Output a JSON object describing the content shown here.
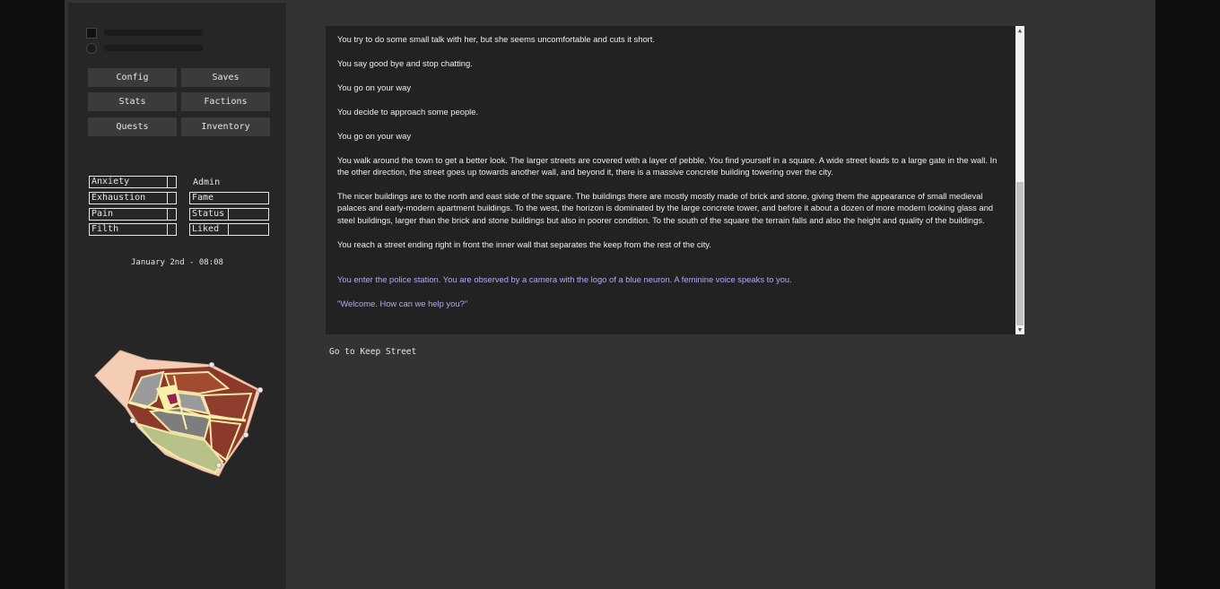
{
  "menu": {
    "config": "Config",
    "saves": "Saves",
    "stats": "Stats",
    "factions": "Factions",
    "quests": "Quests",
    "inventory": "Inventory"
  },
  "meters": {
    "anxiety": {
      "label": "Anxiety",
      "level": 0.9
    },
    "exhaustion": {
      "label": "Exhaustion",
      "level": 0.9
    },
    "pain": {
      "label": "Pain",
      "level": 0.9
    },
    "filth": {
      "label": "Filth",
      "level": 0.9
    },
    "admin": {
      "label": "Admin"
    },
    "fame": {
      "label": "Fame"
    },
    "status": {
      "label": "Status",
      "level": 0.47
    },
    "liked": {
      "label": "Liked",
      "level": 0.47
    }
  },
  "date": "January 2nd - 08:08",
  "story": {
    "p1": "You try to do some small talk with her, but she seems uncomfortable and cuts it short.",
    "p2": "You say good bye and stop chatting.",
    "p3": "You go on your way",
    "p4": "You decide to approach some people.",
    "p5": "You go on your way",
    "p6": "You walk around the town to get a better look. The larger streets are covered with a layer of pebble. You find yourself in a square. A wide street leads to a large gate in the wall. In the other direction, the street goes up towards another wall, and beyond it, there is a massive concrete building towering over the city.",
    "p7": "The nicer buildings are to the north and east side of the square. The buildings there are mostly mostly made of brick and stone, giving them the appearance of small medieval palaces and early-modern apartment buildings. To the west, the horizon is dominated by the large concrete tower, and before it about a dozen of more modern looking glass and steel buildings, larger than the brick and stone buildings but also in poorer condition. To the south of the square the terrain falls and also the height and quality of the buildings.",
    "p8": "You reach a street ending right in front the inner wall that separates the keep from the rest of the city.",
    "p9": "You enter the police station. You are observed by a camera with the logo of a blue neuron. A feminine voice speaks to you.",
    "p10": "\"Welcome. How can we help you?\""
  },
  "actions": {
    "go_keep_street": "Go to Keep Street"
  },
  "colors": {
    "npc_text": "#b6a8f0",
    "panel": "#262626",
    "background": "#333333"
  }
}
